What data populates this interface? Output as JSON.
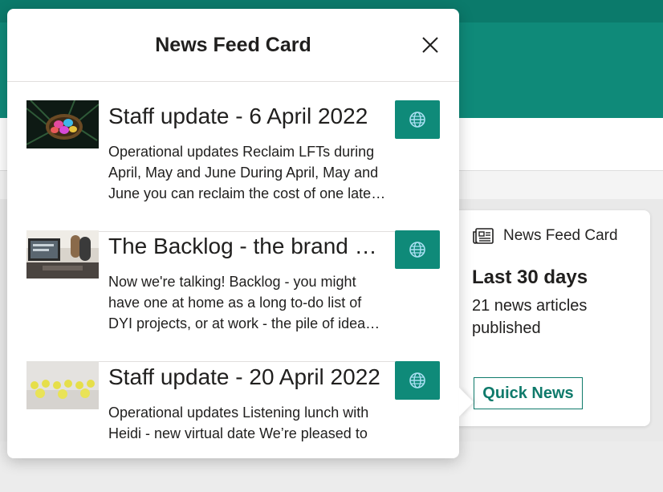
{
  "popup": {
    "title": "News Feed Card",
    "close_icon": "close-icon",
    "items": [
      {
        "title": "Staff update - 6 April 2022",
        "description": "Operational updates Reclaim LFTs during April, May and June During April, May and June you can reclaim the cost of one later test",
        "thumbnail": "easter-eggs-basket-image",
        "action_icon": "globe-icon"
      },
      {
        "title": "The Backlog - the brand new podcast",
        "description": "Now we're talking! Backlog - you might have one at home as a long to-do list of DYI projects, or at work - the pile of ideas and requests",
        "thumbnail": "podcast-studio-image",
        "action_icon": "globe-icon"
      },
      {
        "title": "Staff update - 20 April 2022",
        "description": "Operational updates Listening lunch with Heidi - new virtual date We’re pleased to",
        "thumbnail": "yellow-chicks-image",
        "action_icon": "globe-icon"
      }
    ]
  },
  "card": {
    "icon": "news-icon",
    "title": "News Feed Card",
    "range": "Last 30 days",
    "count_text": "21 news articles published",
    "button_label": "Quick News"
  },
  "colors": {
    "accent": "#0f8a79",
    "accent_dark": "#0b7a6b",
    "button_border": "#0f7a6b"
  }
}
